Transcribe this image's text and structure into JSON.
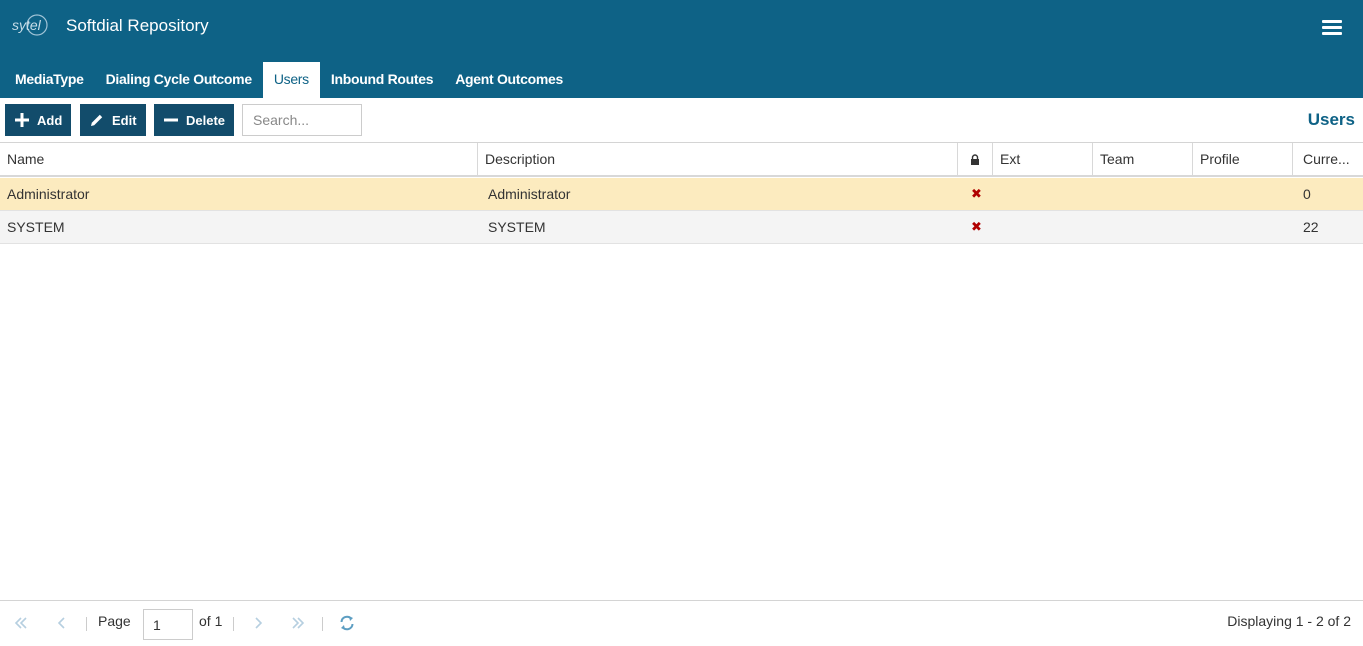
{
  "app": {
    "title": "Softdial Repository",
    "logo_text": "sytel"
  },
  "tabs": [
    {
      "label": "MediaType"
    },
    {
      "label": "Dialing Cycle Outcome"
    },
    {
      "label": "Users",
      "active": true
    },
    {
      "label": "Inbound Routes"
    },
    {
      "label": "Agent Outcomes"
    }
  ],
  "toolbar": {
    "add_label": "Add",
    "edit_label": "Edit",
    "delete_label": "Delete",
    "search_placeholder": "Search...",
    "section_title": "Users"
  },
  "grid": {
    "columns": [
      "Name",
      "Description",
      "lock-icon",
      "Ext",
      "Team",
      "Profile",
      "Curre..."
    ],
    "rows": [
      {
        "name": "Administrator",
        "description": "Administrator",
        "locked": "✖",
        "ext": "",
        "team": "",
        "profile": "",
        "current": "0",
        "selected": true
      },
      {
        "name": "SYSTEM",
        "description": "SYSTEM",
        "locked": "✖",
        "ext": "",
        "team": "",
        "profile": "",
        "current": "22"
      }
    ]
  },
  "pager": {
    "page_label": "Page",
    "page_value": "1",
    "of_label": "of 1",
    "displaying": "Displaying 1 - 2 of 2"
  },
  "colors": {
    "header_bg": "#0e6286",
    "button_bg": "#124c6b",
    "selected_row": "#fcebbf",
    "error_mark": "#b00000"
  }
}
